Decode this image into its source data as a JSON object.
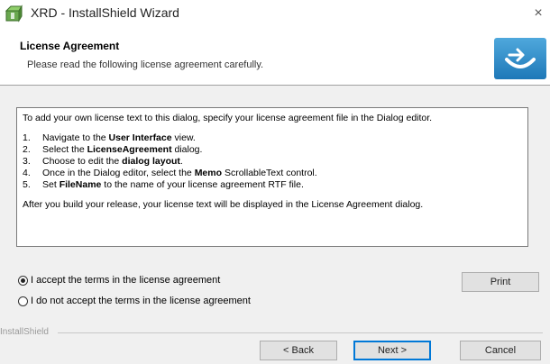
{
  "window": {
    "title": "XRD - InstallShield Wizard",
    "close_glyph": "×"
  },
  "header": {
    "title": "License Agreement",
    "subtitle": "Please read the following license agreement carefully."
  },
  "license": {
    "intro": "To add your own license text to this dialog, specify your license agreement file in the Dialog editor.",
    "steps": [
      {
        "num": "1.",
        "pre": "Navigate to the ",
        "bold": "User Interface",
        "post": " view."
      },
      {
        "num": "2.",
        "pre": "Select the ",
        "bold": "LicenseAgreement",
        "post": " dialog."
      },
      {
        "num": "3.",
        "pre": "Choose to edit the ",
        "bold": "dialog layout",
        "post": "."
      },
      {
        "num": "4.",
        "pre": "Once in the Dialog editor, select the ",
        "bold": "Memo",
        "post": " ScrollableText control."
      },
      {
        "num": "5.",
        "pre": "Set ",
        "bold": "FileName",
        "post": " to the name of your license agreement RTF file."
      }
    ],
    "outro": "After you build your release, your license text will be displayed in the License Agreement dialog."
  },
  "options": {
    "accept": "I accept the terms in the license agreement",
    "decline": "I do not accept the terms in the license agreement",
    "selected": "accept"
  },
  "buttons": {
    "print": "Print",
    "back": "< Back",
    "next": "Next >",
    "cancel": "Cancel"
  },
  "footer": {
    "brand": "InstallShield"
  },
  "icons": {
    "app": "installer-box-icon",
    "logo": "installshield-logo-icon"
  },
  "colors": {
    "logo_blue": "#1e88c8",
    "default_button_border": "#0078d7"
  }
}
